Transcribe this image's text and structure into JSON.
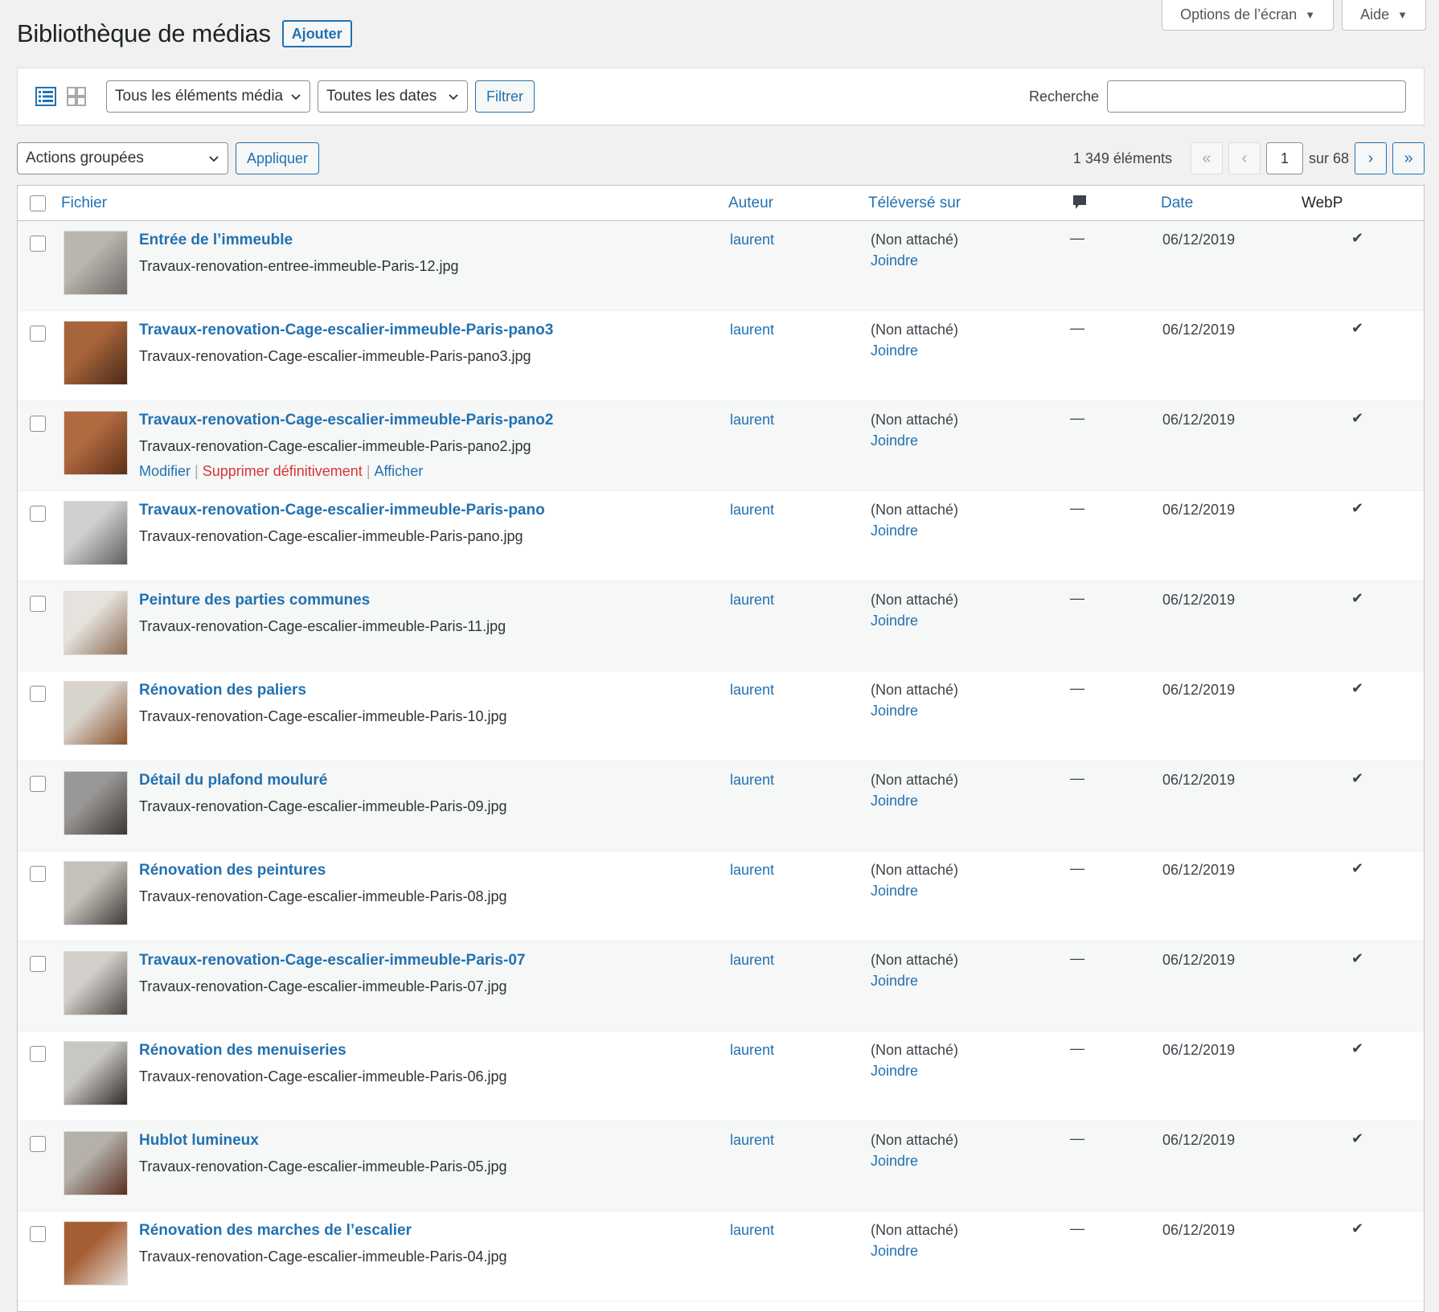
{
  "screen_tabs": {
    "options": "Options de l’écran",
    "help": "Aide"
  },
  "page": {
    "title": "Bibliothèque de médias",
    "add_button": "Ajouter"
  },
  "filters": {
    "media_type": "Tous les éléments média",
    "dates": "Toutes les dates",
    "filter_button": "Filtrer",
    "search_label": "Recherche",
    "search_value": ""
  },
  "bulk": {
    "actions": "Actions groupées",
    "apply": "Appliquer"
  },
  "pagination": {
    "count": "1 349 éléments",
    "first": "«",
    "prev": "‹",
    "current": "1",
    "of": "sur 68",
    "next": "›",
    "last": "»"
  },
  "columns": {
    "file": "Fichier",
    "author": "Auteur",
    "uploaded_to": "Téléversé sur",
    "date": "Date",
    "webp": "WebP"
  },
  "row_actions": {
    "edit": "Modifier",
    "delete": "Supprimer définitivement",
    "view": "Afficher"
  },
  "rows": [
    {
      "title": "Entrée de l’immeuble",
      "filename": "Travaux-renovation-entree-immeuble-Paris-12.jpg",
      "author": "laurent",
      "attached": "(Non attaché)",
      "attach_link": "Joindre",
      "comments": "—",
      "date": "06/12/2019",
      "webp": "✔",
      "thumb_colors": [
        "#b9b6b0",
        "#6d6a66"
      ]
    },
    {
      "title": "Travaux-renovation-Cage-escalier-immeuble-Paris-pano3",
      "filename": "Travaux-renovation-Cage-escalier-immeuble-Paris-pano3.jpg",
      "author": "laurent",
      "attached": "(Non attaché)",
      "attach_link": "Joindre",
      "comments": "—",
      "date": "06/12/2019",
      "webp": "✔",
      "thumb_colors": [
        "#a8643a",
        "#4a2a18"
      ]
    },
    {
      "title": "Travaux-renovation-Cage-escalier-immeuble-Paris-pano2",
      "filename": "Travaux-renovation-Cage-escalier-immeuble-Paris-pano2.jpg",
      "author": "laurent",
      "attached": "(Non attaché)",
      "attach_link": "Joindre",
      "comments": "—",
      "date": "06/12/2019",
      "webp": "✔",
      "thumb_colors": [
        "#b06a40",
        "#5c2f18"
      ],
      "show_actions": true
    },
    {
      "title": "Travaux-renovation-Cage-escalier-immeuble-Paris-pano",
      "filename": "Travaux-renovation-Cage-escalier-immeuble-Paris-pano.jpg",
      "author": "laurent",
      "attached": "(Non attaché)",
      "attach_link": "Joindre",
      "comments": "—",
      "date": "06/12/2019",
      "webp": "✔",
      "thumb_colors": [
        "#cfcfcf",
        "#5e5e5e"
      ]
    },
    {
      "title": "Peinture des parties communes",
      "filename": "Travaux-renovation-Cage-escalier-immeuble-Paris-11.jpg",
      "author": "laurent",
      "attached": "(Non attaché)",
      "attach_link": "Joindre",
      "comments": "—",
      "date": "06/12/2019",
      "webp": "✔",
      "thumb_colors": [
        "#e6e3de",
        "#8a6b52"
      ]
    },
    {
      "title": "Rénovation des paliers",
      "filename": "Travaux-renovation-Cage-escalier-immeuble-Paris-10.jpg",
      "author": "laurent",
      "attached": "(Non attaché)",
      "attach_link": "Joindre",
      "comments": "—",
      "date": "06/12/2019",
      "webp": "✔",
      "thumb_colors": [
        "#d8d4cc",
        "#8a4f2a"
      ]
    },
    {
      "title": "Détail du plafond mouluré",
      "filename": "Travaux-renovation-Cage-escalier-immeuble-Paris-09.jpg",
      "author": "laurent",
      "attached": "(Non attaché)",
      "attach_link": "Joindre",
      "comments": "—",
      "date": "06/12/2019",
      "webp": "✔",
      "thumb_colors": [
        "#9a9896",
        "#3a3634"
      ]
    },
    {
      "title": "Rénovation des peintures",
      "filename": "Travaux-renovation-Cage-escalier-immeuble-Paris-08.jpg",
      "author": "laurent",
      "attached": "(Non attaché)",
      "attach_link": "Joindre",
      "comments": "—",
      "date": "06/12/2019",
      "webp": "✔",
      "thumb_colors": [
        "#c5c1ba",
        "#3e3a36"
      ]
    },
    {
      "title": "Travaux-renovation-Cage-escalier-immeuble-Paris-07",
      "filename": "Travaux-renovation-Cage-escalier-immeuble-Paris-07.jpg",
      "author": "laurent",
      "attached": "(Non attaché)",
      "attach_link": "Joindre",
      "comments": "—",
      "date": "06/12/2019",
      "webp": "✔",
      "thumb_colors": [
        "#d2cfca",
        "#4a4642"
      ]
    },
    {
      "title": "Rénovation des menuiseries",
      "filename": "Travaux-renovation-Cage-escalier-immeuble-Paris-06.jpg",
      "author": "laurent",
      "attached": "(Non attaché)",
      "attach_link": "Joindre",
      "comments": "—",
      "date": "06/12/2019",
      "webp": "✔",
      "thumb_colors": [
        "#c9c7c4",
        "#2e2a28"
      ]
    },
    {
      "title": "Hublot lumineux",
      "filename": "Travaux-renovation-Cage-escalier-immeuble-Paris-05.jpg",
      "author": "laurent",
      "attached": "(Non attaché)",
      "attach_link": "Joindre",
      "comments": "—",
      "date": "06/12/2019",
      "webp": "✔",
      "thumb_colors": [
        "#b4b0aa",
        "#5a2e1e"
      ]
    },
    {
      "title": "Rénovation des marches de l’escalier",
      "filename": "Travaux-renovation-Cage-escalier-immeuble-Paris-04.jpg",
      "author": "laurent",
      "attached": "(Non attaché)",
      "attach_link": "Joindre",
      "comments": "—",
      "date": "06/12/2019",
      "webp": "✔",
      "thumb_colors": [
        "#a65e34",
        "#e2ddd6"
      ]
    }
  ],
  "colors": {
    "accent": "#2271b1",
    "danger": "#d63638",
    "background": "#f1f1f1"
  }
}
